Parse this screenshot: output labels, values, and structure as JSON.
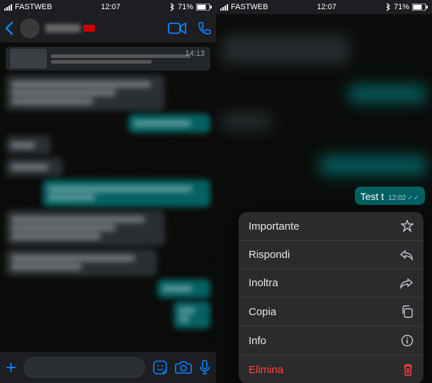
{
  "left": {
    "status": {
      "carrier": "FASTWEB",
      "time": "12:07",
      "battery_pct": "71%"
    },
    "chat": {
      "media_time": "14:13"
    },
    "inputbar": {
      "placeholder": ""
    }
  },
  "right": {
    "status": {
      "carrier": "FASTWEB",
      "time": "12:07",
      "battery_pct": "71%"
    },
    "bubble": {
      "text": "Test t",
      "time": "12:02"
    },
    "menu": {
      "items": [
        {
          "label": "Importante",
          "icon": "star-icon",
          "danger": false
        },
        {
          "label": "Rispondi",
          "icon": "reply-icon",
          "danger": false
        },
        {
          "label": "Inoltra",
          "icon": "forward-icon",
          "danger": false
        },
        {
          "label": "Copia",
          "icon": "copy-icon",
          "danger": false
        },
        {
          "label": "Info",
          "icon": "info-icon",
          "danger": false
        },
        {
          "label": "Elimina",
          "icon": "trash-icon",
          "danger": true
        }
      ]
    }
  }
}
